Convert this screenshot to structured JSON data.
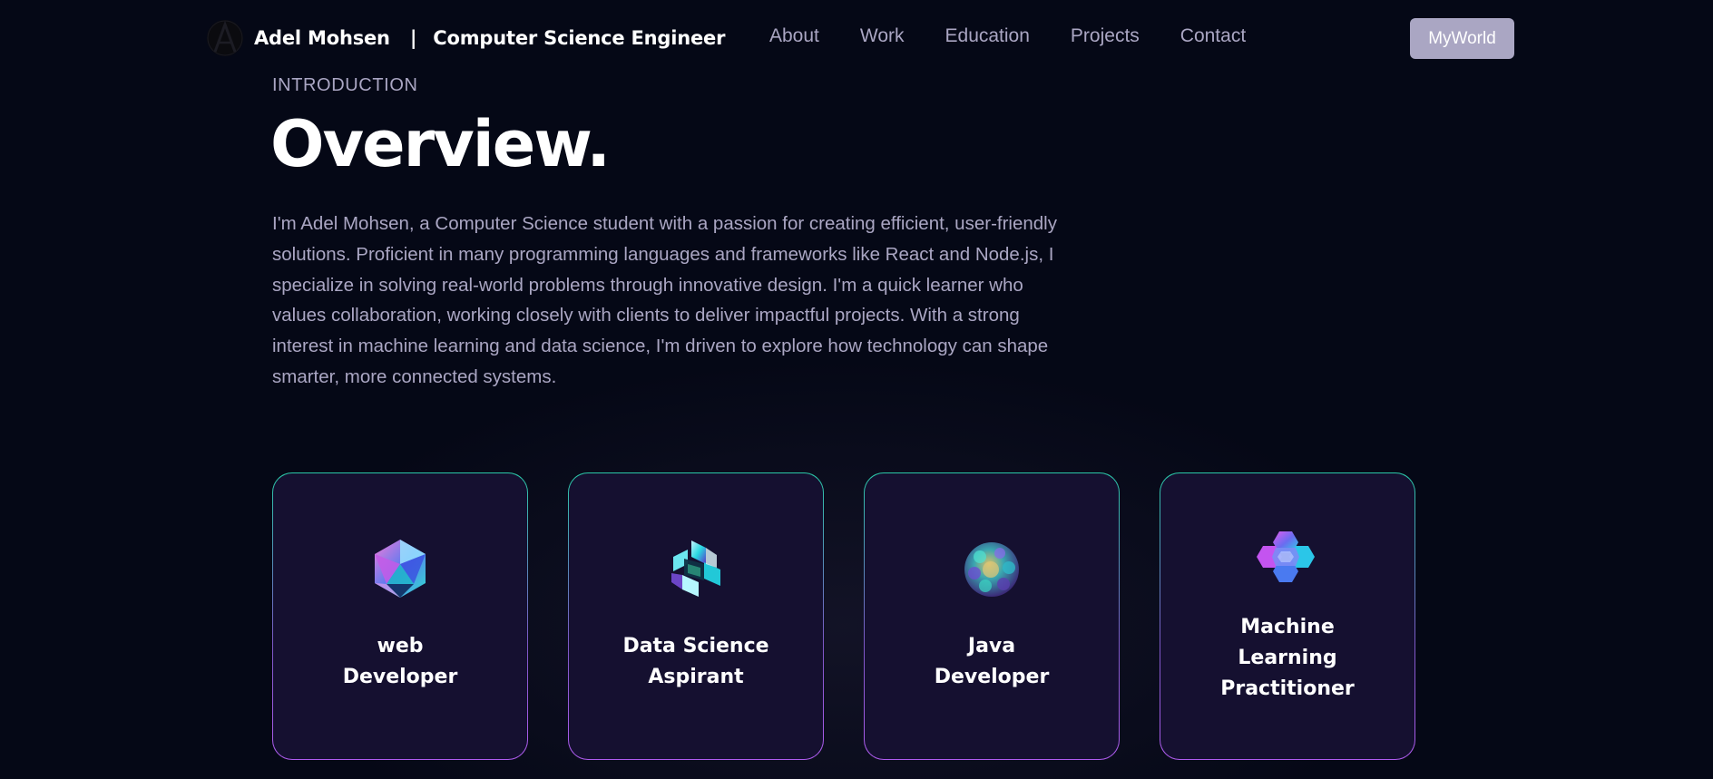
{
  "navbar": {
    "brand_name": "Adel Mohsen",
    "brand_separator": "|",
    "brand_role": "Computer Science Engineer",
    "logo_icon": "letter-a-logo-icon",
    "links": [
      "About",
      "Work",
      "Education",
      "Projects",
      "Contact"
    ],
    "cta_label": "MyWorld"
  },
  "intro": {
    "eyebrow": "INTRODUCTION",
    "title": "Overview.",
    "text": "I'm Adel Mohsen, a Computer Science student with a passion for creating efficient, user-friendly solutions. Proficient in many programming languages and frameworks like React and Node.js, I specialize in solving real-world problems through innovative design. I'm a quick learner who values collaboration, working closely with clients to deliver impactful projects. With a strong interest in machine learning and data science, I'm driven to explore how technology can shape smarter, more connected systems."
  },
  "cards": [
    {
      "title": "web\nDeveloper",
      "icon": "crystal-icosahedron-icon"
    },
    {
      "title": "Data Science\nAspirant",
      "icon": "crystal-cube-frame-icon"
    },
    {
      "title": "Java\nDeveloper",
      "icon": "crystal-sphere-icon"
    },
    {
      "title": "Machine\nLearning\nPractitioner",
      "icon": "crystal-hexagon-cluster-icon"
    }
  ],
  "colors": {
    "background": "#050816",
    "secondary_text": "#aaa6c3",
    "card_background": "#151030",
    "card_border_start": "#2ac9a8",
    "card_border_end": "#b05cf0",
    "cta_background": "#aaa6c3"
  }
}
